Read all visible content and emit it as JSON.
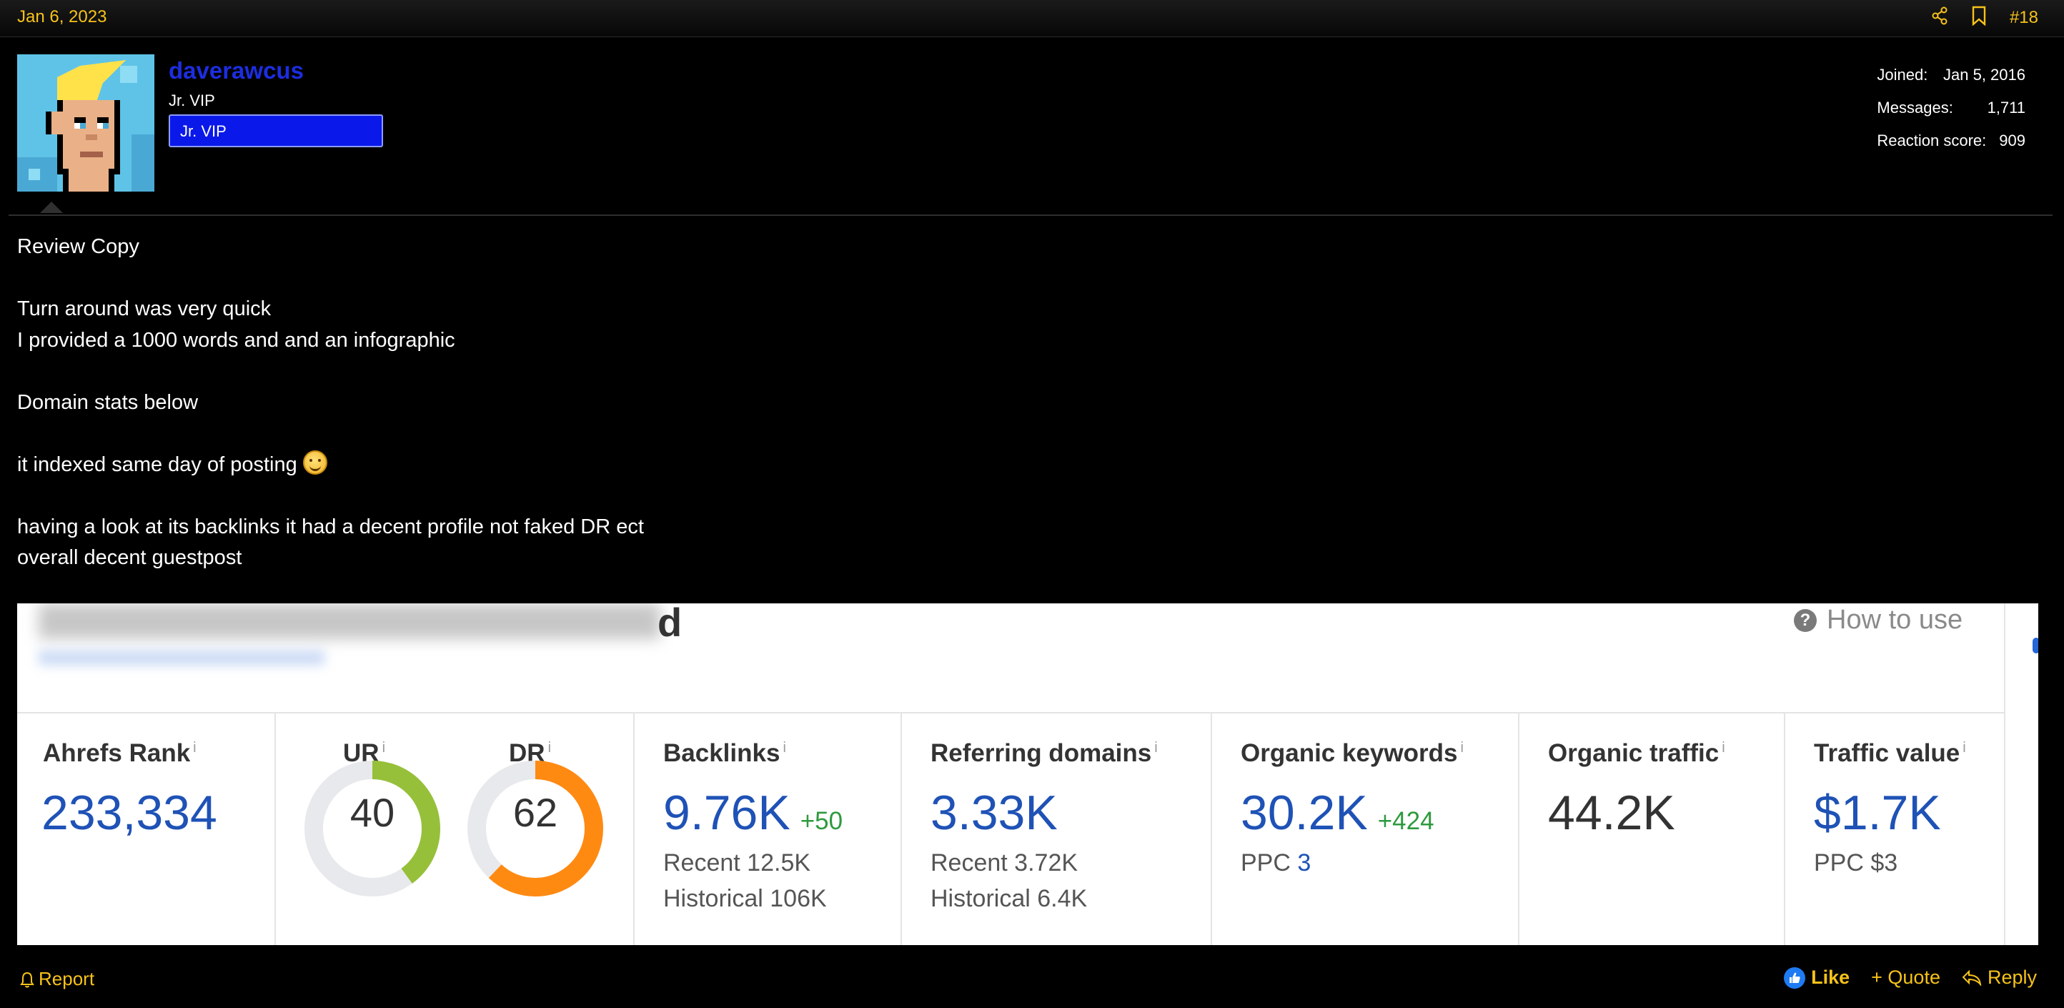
{
  "post": {
    "date": "Jan 6, 2023",
    "number": "#18"
  },
  "user": {
    "name": "daverawcus",
    "title": "Jr. VIP",
    "banner": "Jr. VIP",
    "stats": [
      {
        "label": "Joined:",
        "value": "Jan 5, 2016"
      },
      {
        "label": "Messages:",
        "value": "1,711"
      },
      {
        "label": "Reaction score:",
        "value": "909"
      }
    ]
  },
  "message": {
    "lines": [
      "Review Copy",
      "",
      "Turn around was very quick",
      "I provided a 1000 words and and an infographic",
      "",
      "Domain stats below",
      "",
      "it indexed same day of posting",
      "",
      "having a look at its backlinks it had a decent profile not faked DR ect",
      "overall decent guestpost"
    ]
  },
  "ahrefs": {
    "partial_title_char": "d",
    "how_to_use": "How to use",
    "info_marker": "i",
    "ahrefs_rank": {
      "label": "Ahrefs Rank",
      "value": "233,334"
    },
    "ur": {
      "label": "UR",
      "value": "40",
      "score": 40,
      "color": "#96c03a"
    },
    "dr": {
      "label": "DR",
      "value": "62",
      "score": 62,
      "color": "#ff8a12"
    },
    "backlinks": {
      "label": "Backlinks",
      "value": "9.76K",
      "delta": "+50",
      "recent": "Recent 12.5K",
      "historical": "Historical 106K"
    },
    "referring_domains": {
      "label": "Referring domains",
      "value": "3.33K",
      "recent": "Recent 3.72K",
      "historical": "Historical 6.4K"
    },
    "organic_keywords": {
      "label": "Organic keywords",
      "value": "30.2K",
      "delta": "+424",
      "ppc_label": "PPC",
      "ppc_value": "3"
    },
    "organic_traffic": {
      "label": "Organic traffic",
      "value": "44.2K"
    },
    "traffic_value": {
      "label": "Traffic value",
      "value": "$1.7K",
      "ppc": "PPC $3"
    }
  },
  "actions": {
    "report": "Report",
    "like": "Like",
    "quote": "+ Quote",
    "reply": "Reply"
  },
  "colors": {
    "accent": "#f6c21a",
    "username": "#1d2de0",
    "banner": "#0a19ea",
    "ahrefs_blue": "#1f52b6",
    "delta_green": "#2e9a3e"
  }
}
